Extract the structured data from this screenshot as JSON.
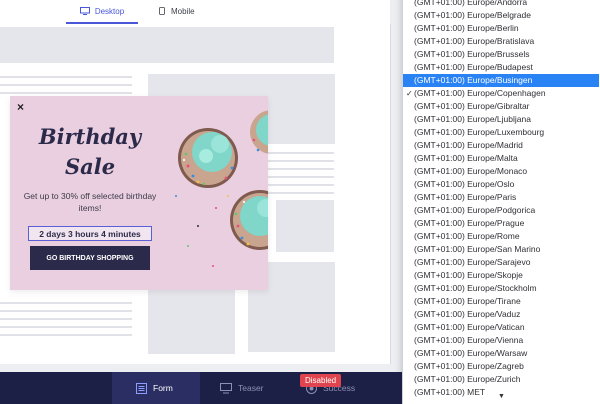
{
  "device_tabs": {
    "desktop": "Desktop",
    "mobile": "Mobile"
  },
  "popup": {
    "close": "×",
    "title_line1": "Birthday",
    "title_line2": "Sale",
    "subtitle": "Get up to 30% off selected birthday items!",
    "timer": "2 days 3 hours 4 minutes",
    "cta": "GO BIRTHDAY SHOPPING"
  },
  "timezones": [
    "(GMT+01:00) Europe/Andorra",
    "(GMT+01:00) Europe/Belgrade",
    "(GMT+01:00) Europe/Berlin",
    "(GMT+01:00) Europe/Bratislava",
    "(GMT+01:00) Europe/Brussels",
    "(GMT+01:00) Europe/Budapest",
    "(GMT+01:00) Europe/Busingen",
    "(GMT+01:00) Europe/Copenhagen",
    "(GMT+01:00) Europe/Gibraltar",
    "(GMT+01:00) Europe/Ljubljana",
    "(GMT+01:00) Europe/Luxembourg",
    "(GMT+01:00) Europe/Madrid",
    "(GMT+01:00) Europe/Malta",
    "(GMT+01:00) Europe/Monaco",
    "(GMT+01:00) Europe/Oslo",
    "(GMT+01:00) Europe/Paris",
    "(GMT+01:00) Europe/Podgorica",
    "(GMT+01:00) Europe/Prague",
    "(GMT+01:00) Europe/Rome",
    "(GMT+01:00) Europe/San Marino",
    "(GMT+01:00) Europe/Sarajevo",
    "(GMT+01:00) Europe/Skopje",
    "(GMT+01:00) Europe/Stockholm",
    "(GMT+01:00) Europe/Tirane",
    "(GMT+01:00) Europe/Vaduz",
    "(GMT+01:00) Europe/Vatican",
    "(GMT+01:00) Europe/Vienna",
    "(GMT+01:00) Europe/Warsaw",
    "(GMT+01:00) Europe/Zagreb",
    "(GMT+01:00) Europe/Zurich",
    "(GMT+01:00) MET"
  ],
  "timezone_highlighted": "(GMT+01:00) Europe/Busingen",
  "timezone_checked": "(GMT+01:00) Europe/Copenhagen",
  "bottom_tabs": {
    "form": "Form",
    "teaser": "Teaser",
    "success": "Success"
  },
  "badge": "Disabled",
  "colors": {
    "accent": "#4a57d8",
    "selection": "#2a83f4",
    "navy": "#2c2a4a",
    "popup_bg": "#eacfe0",
    "badge_red": "#e0454f"
  }
}
